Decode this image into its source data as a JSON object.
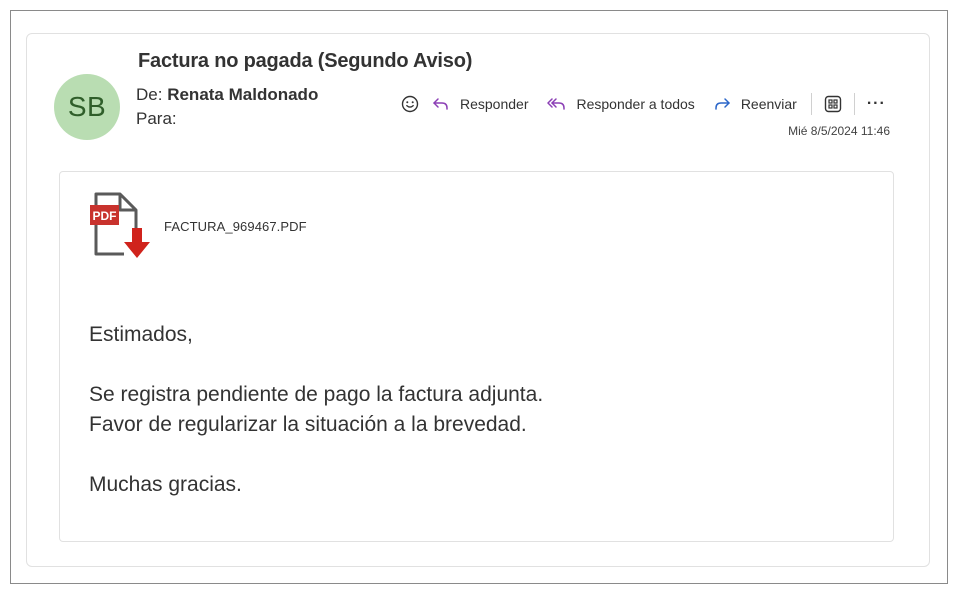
{
  "email": {
    "subject": "Factura no pagada (Segundo Aviso)",
    "avatar_initials": "SB",
    "from_label": "De:",
    "from_name": "Renata Maldonado",
    "to_label": "Para:",
    "timestamp": "Mié 8/5/2024 11:46"
  },
  "toolbar": {
    "reply_label": "Responder",
    "reply_all_label": "Responder a todos",
    "forward_label": "Reenviar",
    "more_label": "···",
    "icons": [
      "smiley-icon",
      "reply-icon",
      "reply-all-icon",
      "forward-icon",
      "apps-icon",
      "more-icon"
    ],
    "reply_icon_color": "#8b3fb5",
    "forward_icon_color": "#2b66c9"
  },
  "attachment": {
    "file_name": "FACTURA_969467.PDF",
    "badge": "PDF",
    "icon": "pdf-download-icon",
    "badge_color": "#c8322d",
    "arrow_color": "#d0231c"
  },
  "body": {
    "greeting": "Estimados,",
    "line1": "Se registra pendiente de pago la factura adjunta.",
    "line2": "Favor de regularizar la situación a la brevedad.",
    "closing": "Muchas gracias."
  }
}
